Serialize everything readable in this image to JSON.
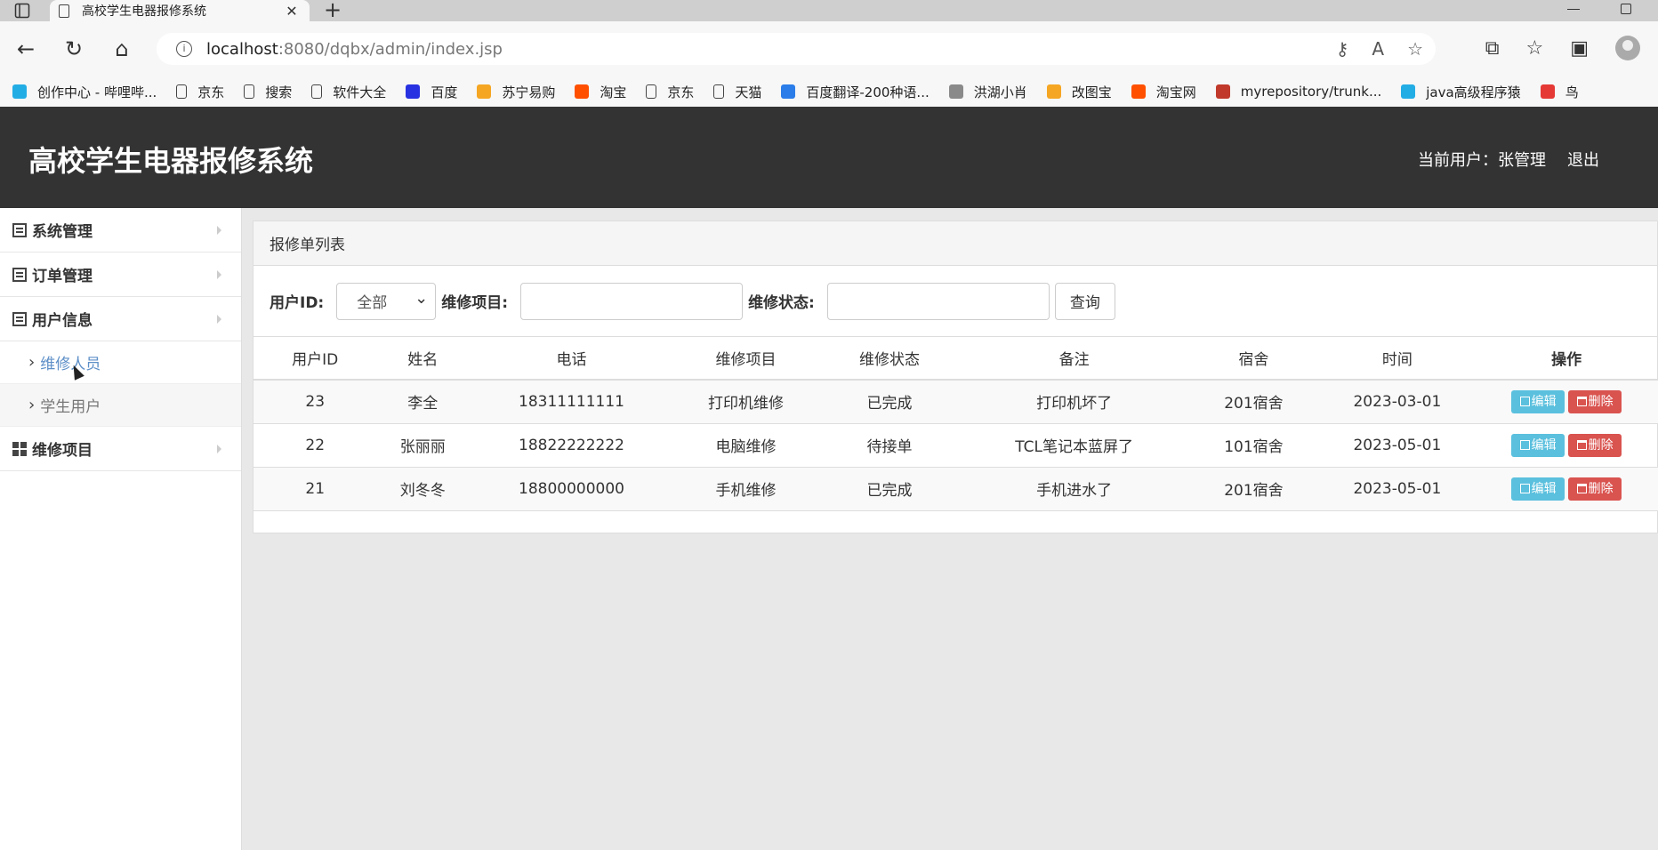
{
  "browser": {
    "tab_title": "高校学生电器报修系统",
    "url_host": "localhost",
    "url_path": ":8080/dqbx/admin/index.jsp",
    "bookmarks": [
      {
        "label": "创作中心 - 哔哩哔...",
        "color": "#23ade5"
      },
      {
        "label": "京东",
        "color": "file"
      },
      {
        "label": "搜索",
        "color": "file"
      },
      {
        "label": "软件大全",
        "color": "file"
      },
      {
        "label": "百度",
        "color": "#2932e1"
      },
      {
        "label": "苏宁易购",
        "color": "#f5a623"
      },
      {
        "label": "淘宝",
        "color": "#ff5000"
      },
      {
        "label": "京东",
        "color": "file"
      },
      {
        "label": "天猫",
        "color": "file"
      },
      {
        "label": "百度翻译-200种语...",
        "color": "#2b7de9"
      },
      {
        "label": "洪湖小肖",
        "color": "#8a8a8a"
      },
      {
        "label": "改图宝",
        "color": "#f5a623"
      },
      {
        "label": "淘宝网",
        "color": "#ff5000"
      },
      {
        "label": "myrepository/trunk...",
        "color": "#c0392b"
      },
      {
        "label": "java高级程序猿",
        "color": "#23ade5"
      },
      {
        "label": "鸟",
        "color": "#e53935"
      }
    ]
  },
  "header": {
    "brand": "高校学生电器报修系统",
    "user_label": "当前用户：张管理",
    "logout": "退出"
  },
  "sidebar": {
    "items": [
      {
        "label": "系统管理"
      },
      {
        "label": "订单管理"
      },
      {
        "label": "用户信息"
      }
    ],
    "sub_items": [
      {
        "label": "维修人员"
      },
      {
        "label": "学生用户"
      }
    ],
    "last_item": {
      "label": "维修项目"
    }
  },
  "panel": {
    "title": "报修单列表",
    "filters": {
      "user_id_label": "用户ID:",
      "user_id_value": "全部",
      "item_label": "维修项目:",
      "status_label": "维修状态:",
      "query": "查询"
    },
    "columns": [
      "用户ID",
      "姓名",
      "电话",
      "维修项目",
      "维修状态",
      "备注",
      "宿舍",
      "时间",
      "操作"
    ],
    "rows": [
      [
        "23",
        "李全",
        "18311111111",
        "打印机维修",
        "已完成",
        "打印机坏了",
        "201宿舍",
        "2023-03-01"
      ],
      [
        "22",
        "张丽丽",
        "18822222222",
        "电脑维修",
        "待接单",
        "TCL笔记本蓝屏了",
        "101宿舍",
        "2023-05-01"
      ],
      [
        "21",
        "刘冬冬",
        "18800000000",
        "手机维修",
        "已完成",
        "手机进水了",
        "201宿舍",
        "2023-05-01"
      ]
    ],
    "edit_label": "编辑",
    "delete_label": "删除"
  }
}
